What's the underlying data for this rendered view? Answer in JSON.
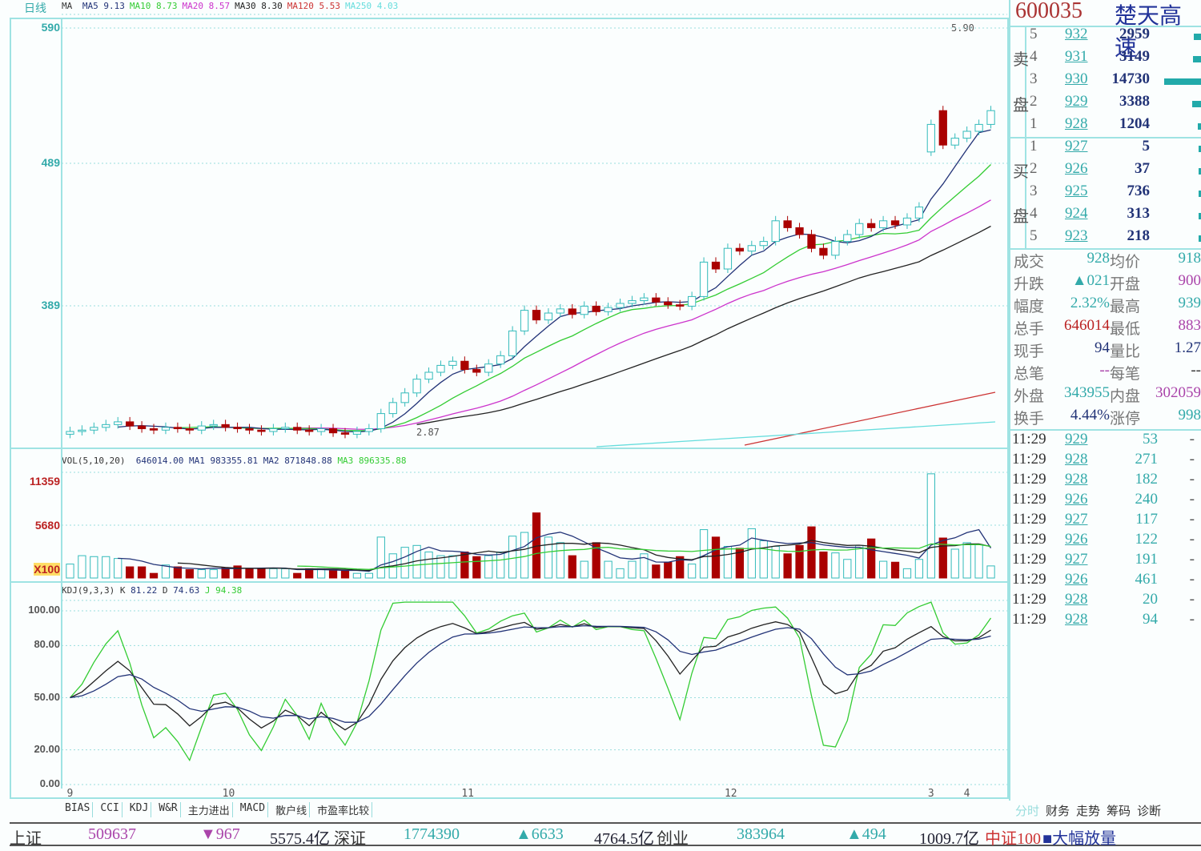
{
  "header": {
    "period": "日线",
    "ma_prefix": "MA",
    "ma": [
      {
        "label": "MA5",
        "value": "9.13",
        "color": "#223377"
      },
      {
        "label": "MA10",
        "value": "8.73",
        "color": "#3c3"
      },
      {
        "label": "MA20",
        "value": "8.57",
        "color": "#c3c"
      },
      {
        "label": "MA30",
        "value": "8.30",
        "color": "#222"
      },
      {
        "label": "MA120",
        "value": "5.53",
        "color": "#c33"
      },
      {
        "label": "MA250",
        "value": "4.03",
        "color": "#6dd"
      }
    ]
  },
  "price_axis": {
    "labels": [
      "590",
      "489",
      "389"
    ],
    "values": [
      590,
      489,
      389
    ],
    "high_marker": "5.90",
    "low_marker": "2.87"
  },
  "volume": {
    "title": "VOL(5,10,20)",
    "value": "646014.00",
    "ma1_label": "MA1",
    "ma1": "983355.81",
    "ma2_label": "MA2",
    "ma2": "871848.88",
    "ma3_label": "MA3",
    "ma3": "896335.88",
    "axis": [
      "11359",
      "5680",
      "X100"
    ],
    "max": 11359
  },
  "kdj": {
    "title": "KDJ(9,3,3)",
    "k_label": "K",
    "k": "81.22",
    "d_label": "D",
    "d": "74.63",
    "j_label": "J",
    "j": "94.38",
    "axis": [
      "100.00",
      "80.00",
      "50.00",
      "20.00",
      "0.00"
    ],
    "axis_values": [
      100,
      80,
      50,
      20,
      0
    ]
  },
  "x_axis": [
    {
      "label": "9",
      "index": 0
    },
    {
      "label": "10",
      "index": 13
    },
    {
      "label": "11",
      "index": 33
    },
    {
      "label": "12",
      "index": 55
    },
    {
      "label": "3",
      "index": 72
    },
    {
      "label": "4",
      "index": 75
    }
  ],
  "indicator_tabs": [
    "BIAS",
    "CCI",
    "KDJ",
    "W&R",
    "主力进出",
    "MACD",
    "散户线",
    "市盈率比较"
  ],
  "right_tabs": [
    "分时",
    "财务",
    "走势",
    "筹码",
    "诊断"
  ],
  "quote": {
    "code": "600035",
    "name": "楚天高速",
    "sell_label": [
      "卖",
      "盘"
    ],
    "buy_label": [
      "买",
      "盘"
    ],
    "sell": [
      {
        "n": "5",
        "price": "932",
        "vol": "2959"
      },
      {
        "n": "4",
        "price": "931",
        "vol": "3149"
      },
      {
        "n": "3",
        "price": "930",
        "vol": "14730"
      },
      {
        "n": "2",
        "price": "929",
        "vol": "3388"
      },
      {
        "n": "1",
        "price": "928",
        "vol": "1204"
      }
    ],
    "buy": [
      {
        "n": "1",
        "price": "927",
        "vol": "5"
      },
      {
        "n": "2",
        "price": "926",
        "vol": "37"
      },
      {
        "n": "3",
        "price": "925",
        "vol": "736"
      },
      {
        "n": "4",
        "price": "924",
        "vol": "313"
      },
      {
        "n": "5",
        "price": "923",
        "vol": "218"
      }
    ],
    "stats": [
      {
        "l1": "成交",
        "v1": "928",
        "l2": "均价",
        "v2": "918",
        "c1": "#3aa",
        "c2": "#3aa"
      },
      {
        "l1": "升跌",
        "v1": "▲021",
        "l2": "开盘",
        "v2": "900",
        "c1": "#3aa",
        "c2": "#a4a"
      },
      {
        "l1": "幅度",
        "v1": "2.32%",
        "l2": "最高",
        "v2": "939",
        "c1": "#3aa",
        "c2": "#3aa"
      },
      {
        "l1": "总手",
        "v1": "646014",
        "l2": "最低",
        "v2": "883",
        "c1": "#b22",
        "c2": "#a4a"
      },
      {
        "l1": "现手",
        "v1": "94",
        "l2": "量比",
        "v2": "1.27",
        "c1": "#223377",
        "c2": "#223377"
      },
      {
        "l1": "总笔",
        "v1": "--",
        "l2": "每笔",
        "v2": "--",
        "c1": "#a4a",
        "c2": "#333"
      },
      {
        "l1": "外盘",
        "v1": "343955",
        "l2": "内盘",
        "v2": "302059",
        "c1": "#3aa",
        "c2": "#a4a"
      },
      {
        "l1": "换手",
        "v1": "4.44%",
        "l2": "涨停",
        "v2": "998",
        "c1": "#223377",
        "c2": "#3aa"
      }
    ]
  },
  "ticks": [
    {
      "t": "11:29",
      "p": "929",
      "v": "53"
    },
    {
      "t": "11:29",
      "p": "928",
      "v": "271"
    },
    {
      "t": "11:29",
      "p": "928",
      "v": "182"
    },
    {
      "t": "11:29",
      "p": "926",
      "v": "240"
    },
    {
      "t": "11:29",
      "p": "927",
      "v": "117"
    },
    {
      "t": "11:29",
      "p": "926",
      "v": "122"
    },
    {
      "t": "11:29",
      "p": "927",
      "v": "191"
    },
    {
      "t": "11:29",
      "p": "926",
      "v": "461"
    },
    {
      "t": "11:29",
      "p": "928",
      "v": "20"
    },
    {
      "t": "11:29",
      "p": "928",
      "v": "94"
    }
  ],
  "status": {
    "sh_label": "上证",
    "sh_vol": "509637",
    "sh_chg": "▼967",
    "sh_amt": "5575.4亿",
    "sz_label": "深证",
    "sz_vol": "1774390",
    "sz_chg": "▲6633",
    "sz_amt": "4764.5亿",
    "cy_label": "创业",
    "cy_vol": "383964",
    "cy_chg": "▲494",
    "cy_amt": "1009.7亿",
    "zz_label": "中证100",
    "alert": "■大幅放量"
  },
  "chart_data": {
    "type": "candlestick",
    "ylim": [
      287,
      597
    ],
    "close": [
      297,
      298,
      300,
      302,
      304,
      301,
      299,
      298,
      300,
      299,
      298,
      301,
      302,
      300,
      299,
      298,
      297,
      299,
      300,
      298,
      297,
      299,
      296,
      295,
      297,
      299,
      310,
      318,
      325,
      335,
      340,
      345,
      348,
      342,
      340,
      346,
      352,
      370,
      385,
      378,
      383,
      386,
      382,
      388,
      384,
      387,
      390,
      392,
      394,
      391,
      389,
      388,
      395,
      420,
      415,
      430,
      428,
      432,
      435,
      450,
      445,
      440,
      430,
      425,
      435,
      440,
      448,
      445,
      450,
      447,
      452,
      460,
      520,
      505,
      510,
      515,
      520,
      530
    ],
    "open": [
      295,
      297,
      298,
      300,
      302,
      304,
      301,
      299,
      298,
      300,
      299,
      298,
      301,
      302,
      300,
      299,
      298,
      297,
      299,
      300,
      298,
      297,
      299,
      296,
      295,
      297,
      299,
      310,
      318,
      325,
      335,
      340,
      345,
      348,
      342,
      340,
      346,
      352,
      370,
      385,
      378,
      383,
      386,
      382,
      388,
      384,
      387,
      390,
      392,
      394,
      391,
      389,
      388,
      395,
      420,
      415,
      430,
      428,
      432,
      435,
      450,
      445,
      440,
      430,
      425,
      435,
      440,
      448,
      445,
      450,
      447,
      452,
      500,
      530,
      505,
      510,
      515,
      520
    ],
    "volume": [
      1500,
      2400,
      2300,
      2300,
      2100,
      1200,
      1200,
      500,
      1400,
      1200,
      900,
      900,
      900,
      1100,
      1300,
      1000,
      1000,
      1000,
      1000,
      500,
      1000,
      1000,
      800,
      800,
      500,
      500,
      4400,
      2600,
      3300,
      3500,
      2800,
      2400,
      2400,
      2800,
      2300,
      2400,
      2800,
      4500,
      4900,
      7000,
      4400,
      3800,
      2400,
      1800,
      3800,
      1800,
      1000,
      1800,
      2600,
      1400,
      1700,
      2300,
      1500,
      5200,
      4400,
      3400,
      3200,
      5300,
      4000,
      3400,
      2600,
      3500,
      5500,
      2800,
      2700,
      2000,
      3500,
      4200,
      1800,
      1700,
      1000,
      2000,
      11200,
      4300,
      3100,
      3800,
      3600,
      1300
    ]
  }
}
